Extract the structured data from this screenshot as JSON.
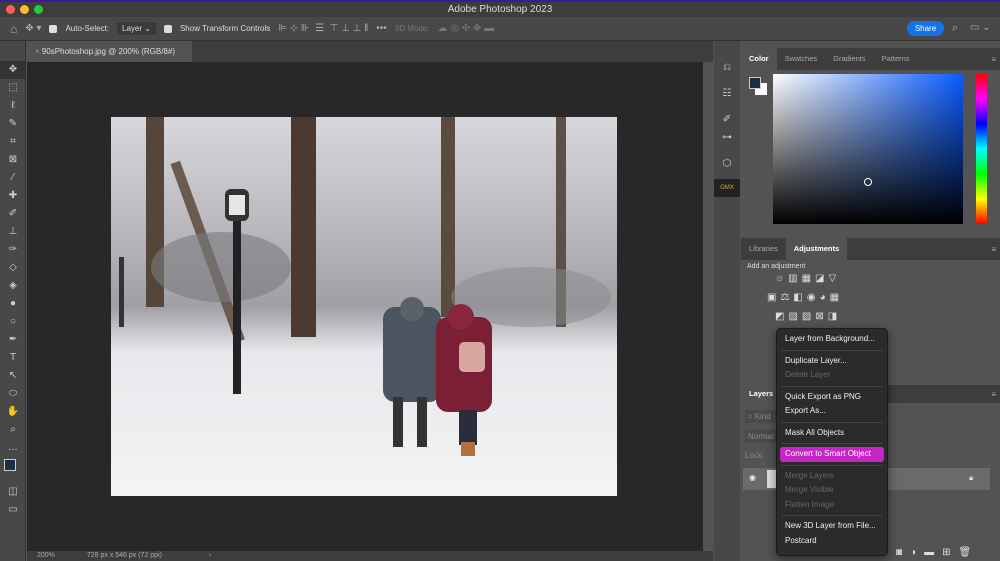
{
  "app": {
    "title": "Adobe Photoshop 2023"
  },
  "options": {
    "auto_select_label": "Auto-Select:",
    "layer_select": "Layer",
    "show_transform_label": "Show Transform Controls",
    "mode_3d": "3D Mode:",
    "share": "Share"
  },
  "document": {
    "tab": "90sPhotoshop.jpg @ 200% (RGB/8#)",
    "zoom": "200%",
    "info": "728 px x 546 px (72 ppi)"
  },
  "color_panel": {
    "tabs": [
      "Color",
      "Swatches",
      "Gradients",
      "Patterns"
    ]
  },
  "adjust_panel": {
    "tabs": [
      "Libraries",
      "Adjustments"
    ],
    "hint": "Add an adjustment"
  },
  "layers_panel": {
    "title": "Layers",
    "kind": "Kind",
    "blend": "Normal",
    "lock": "Lock:"
  },
  "context_menu": {
    "items": [
      "Layer from Background...",
      "Duplicate Layer...",
      "Delete Layer",
      "Quick Export as PNG",
      "Export As...",
      "Mask All Objects",
      "Convert to Smart Object",
      "Merge Layers",
      "Merge Visible",
      "Flatten Image",
      "New 3D Layer from File...",
      "Postcard"
    ]
  },
  "colors": {
    "accent": "#1473e6",
    "highlight": "#c626c6"
  }
}
